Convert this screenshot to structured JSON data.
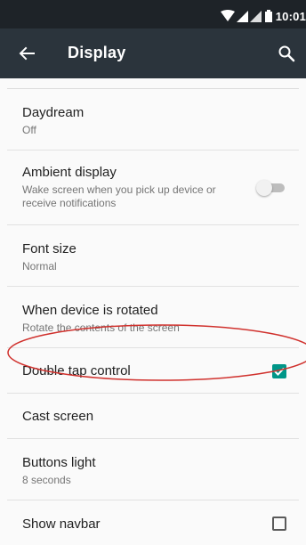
{
  "status_bar": {
    "time": "10:01"
  },
  "app_bar": {
    "title": "Display"
  },
  "settings": [
    {
      "title": "Daydream",
      "subtitle": "Off"
    },
    {
      "title": "Ambient display",
      "subtitle_line1": "Wake screen when you pick up device or",
      "subtitle_line2": "receive notifications",
      "toggle": "off"
    },
    {
      "title": "Font size",
      "subtitle": "Normal"
    },
    {
      "title": "When device is rotated",
      "subtitle": "Rotate the contents of the screen"
    },
    {
      "title": "Double tap control",
      "checked": true
    },
    {
      "title": "Cast screen"
    },
    {
      "title": "Buttons light",
      "subtitle": "8 seconds"
    },
    {
      "title": "Show navbar",
      "checked": false
    }
  ],
  "colors": {
    "accent": "#009688",
    "annotation": "#d0312d",
    "app_bar": "#2b343c",
    "status_bar": "#1e2328"
  }
}
